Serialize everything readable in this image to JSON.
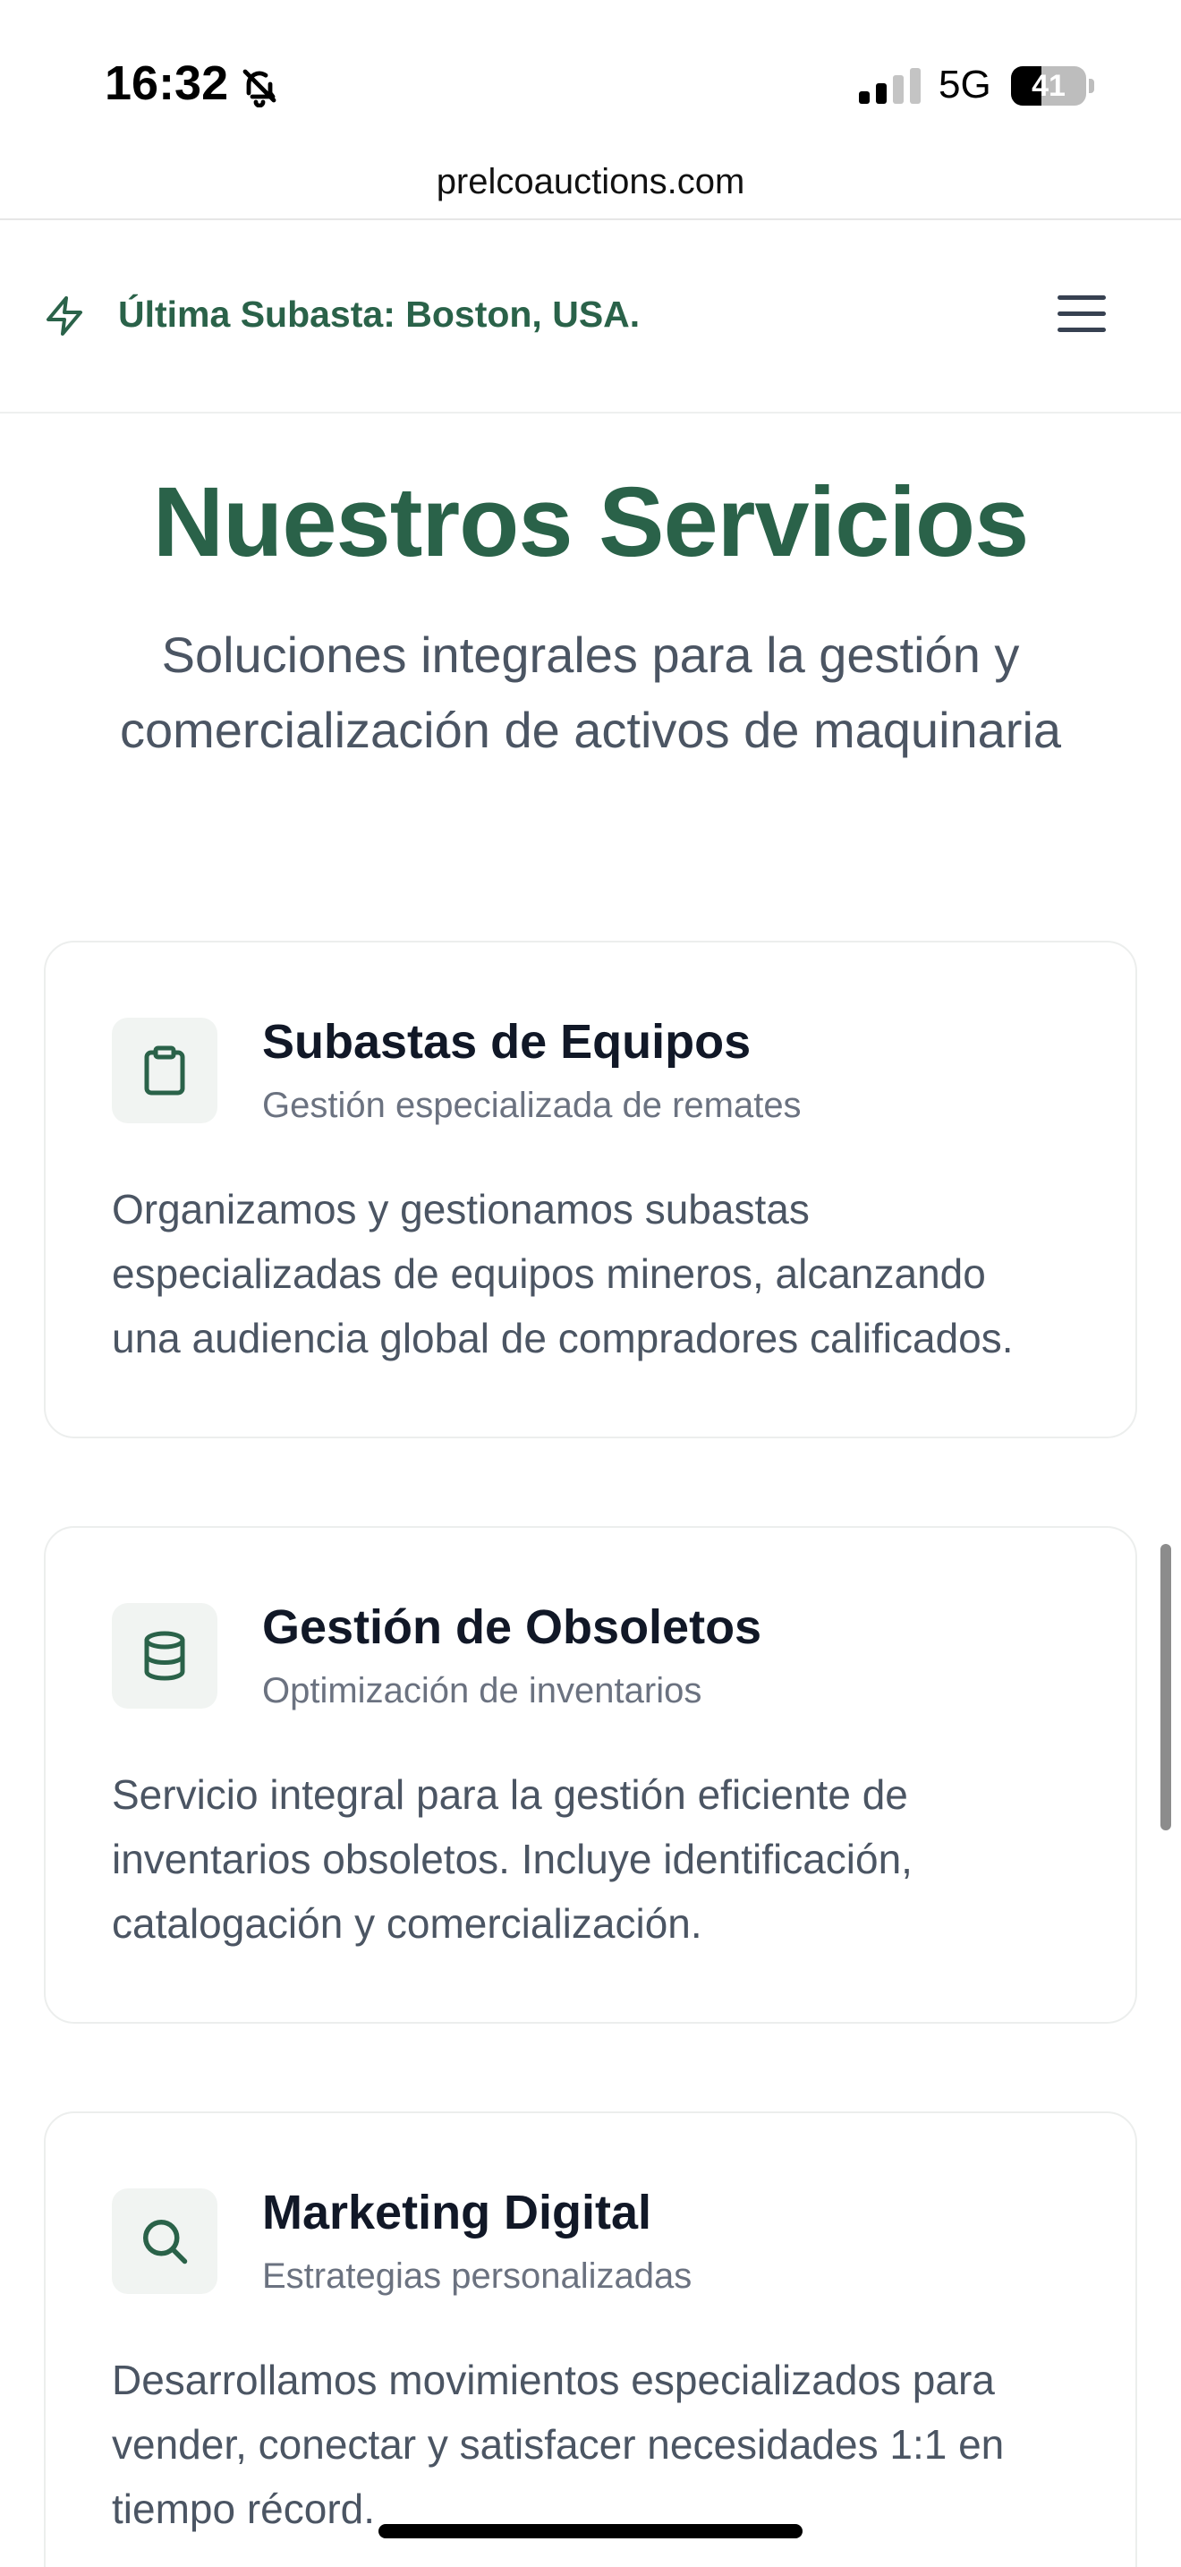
{
  "status_bar": {
    "time": "16:32",
    "network": "5G",
    "battery_percent": "41",
    "battery_level": 0.41,
    "icons": [
      "bell-slash-icon",
      "signal-icon"
    ]
  },
  "browser": {
    "url": "prelcoauctions.com"
  },
  "header": {
    "announcement": "Última Subasta: Boston, USA.",
    "icons": [
      "lightning-bolt-icon",
      "hamburger-menu-icon"
    ]
  },
  "hero": {
    "title": "Nuestros Servicios",
    "subtitle_line1": "Soluciones integrales para la gestión y",
    "subtitle_line2": "comercialización de activos de maquinaria"
  },
  "services": [
    {
      "icon": "clipboard-icon",
      "title": "Subastas de Equipos",
      "subtitle": "Gestión especializada de remates",
      "desc_line1": "Organizamos y gestionamos subastas",
      "desc_line2": "especializadas de equipos mineros, alcanzando",
      "desc_line3": "una audiencia global de compradores calificados."
    },
    {
      "icon": "database-icon",
      "title": "Gestión de Obsoletos",
      "subtitle": "Optimización de inventarios",
      "desc_line1": "Servicio integral para la gestión eficiente de",
      "desc_line2": "inventarios obsoletos. Incluye identificación,",
      "desc_line3": "catalogación y comercialización."
    },
    {
      "icon": "search-icon",
      "title": "Marketing Digital",
      "subtitle": "Estrategias personalizadas",
      "desc_line1": "Desarrollamos movimientos especializados para",
      "desc_line2": "vender, conectar y satisfacer necesidades 1:1 en",
      "desc_line3": "tiempo récord."
    }
  ],
  "colors": {
    "brand_green": "#2a6249",
    "text_dark": "#111827",
    "text_muted": "#6b7280",
    "text_body": "#4b5563"
  }
}
